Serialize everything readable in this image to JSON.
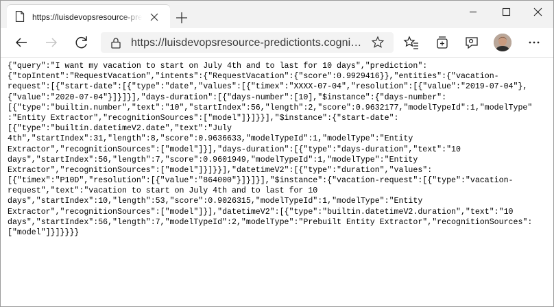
{
  "tab": {
    "title": "https://luisdevopsresource-predictions"
  },
  "address_bar": {
    "url": "https://luisdevopsresource-predictionts.cogni…"
  },
  "icons": {
    "tab": [
      "page-icon",
      "close-icon",
      "new-tab-icon"
    ],
    "window": [
      "minimize-icon",
      "maximize-icon",
      "window-close-icon"
    ],
    "toolbar": [
      "back-icon",
      "forward-icon",
      "refresh-icon",
      "lock-icon",
      "favorite-star-icon",
      "favorites-list-icon",
      "collections-icon",
      "feedback-icon",
      "profile-avatar",
      "more-menu-icon"
    ]
  },
  "json_response": {
    "lines": [
      "{\"query\":\"I want my vacation to start on July 4th and to last for 10 days\",\"prediction\":",
      "{\"topIntent\":\"RequestVacation\",\"intents\":{\"RequestVacation\":{\"score\":0.9929416}},\"entities\":{\"vacation-",
      "request\":[{\"start-date\":[{\"type\":\"date\",\"values\":[{\"timex\":\"XXXX-07-04\",\"resolution\":[{\"value\":\"2019-07-04\"},",
      "{\"value\":\"2020-07-04\"}]}]}],\"days-duration\":[{\"days-number\":[10],\"$instance\":{\"days-number\":",
      "[{\"type\":\"builtin.number\",\"text\":\"10\",\"startIndex\":56,\"length\":2,\"score\":0.9632177,\"modelTypeId\":1,\"modelType\"",
      ":\"Entity Extractor\",\"recognitionSources\":[\"model\"]}]}}],\"$instance\":{\"start-date\":",
      "[{\"type\":\"builtin.datetimeV2.date\",\"text\":\"July",
      "4th\",\"startIndex\":31,\"length\":8,\"score\":0.9636633,\"modelTypeId\":1,\"modelType\":\"Entity",
      "Extractor\",\"recognitionSources\":[\"model\"]}],\"days-duration\":[{\"type\":\"days-duration\",\"text\":\"10",
      "days\",\"startIndex\":56,\"length\":7,\"score\":0.9601949,\"modelTypeId\":1,\"modelType\":\"Entity",
      "Extractor\",\"recognitionSources\":[\"model\"]}]}}],\"datetimeV2\":[{\"type\":\"duration\",\"values\":",
      "[{\"timex\":\"P10D\",\"resolution\":[{\"value\":\"864000\"}]}]}],\"$instance\":{\"vacation-request\":[{\"type\":\"vacation-",
      "request\",\"text\":\"vacation to start on July 4th and to last for 10",
      "days\",\"startIndex\":10,\"length\":53,\"score\":0.9026315,\"modelTypeId\":1,\"modelType\":\"Entity",
      "Extractor\",\"recognitionSources\":[\"model\"]}],\"datetimeV2\":[{\"type\":\"builtin.datetimeV2.duration\",\"text\":\"10",
      "days\",\"startIndex\":56,\"length\":7,\"modelTypeId\":2,\"modelType\":\"Prebuilt Entity Extractor\",\"recognitionSources\":",
      "[\"model\"]}]}}}}"
    ]
  }
}
